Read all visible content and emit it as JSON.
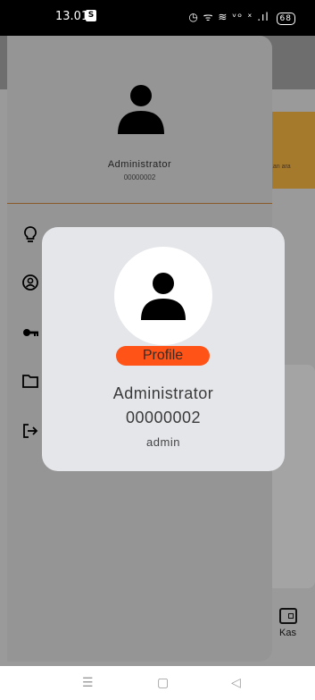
{
  "status_bar": {
    "time": "13.01",
    "sim_badge": "S",
    "icons_text": "◷ ᯤ ≋ ᵛᵒ ˣ .ıl",
    "battery": "68"
  },
  "background_app": {
    "banner_text": "...an ara",
    "nav_kas": "Kas"
  },
  "drawer": {
    "user_name": "Administrator",
    "user_id": "00000002",
    "menu_icons": [
      "lightbulb-icon",
      "account-circle-icon",
      "key-icon",
      "folder-icon",
      "logout-icon"
    ]
  },
  "profile_dialog": {
    "tag": "Profile",
    "name": "Administrator",
    "id": "00000002",
    "role": "admin",
    "accent_color": "#ff5317"
  },
  "nav_bar": {
    "menu": "☰",
    "home": "▢",
    "back": "◁"
  }
}
